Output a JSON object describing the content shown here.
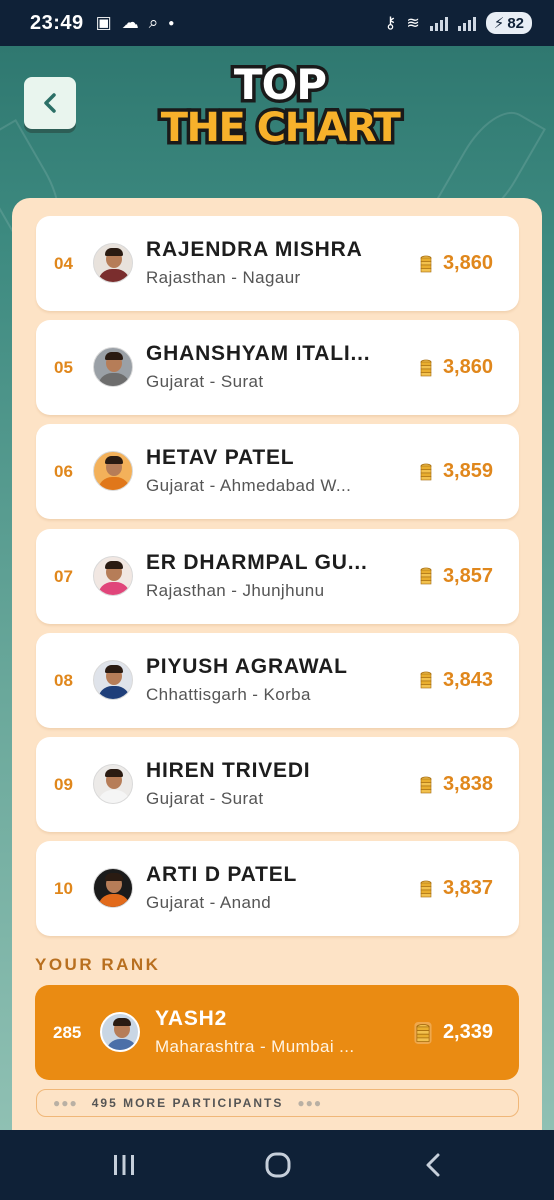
{
  "status_bar": {
    "time": "23:49",
    "battery": "82"
  },
  "header": {
    "title_line1": "TOP",
    "title_line2": "THE CHART"
  },
  "leaderboard": [
    {
      "rank": "04",
      "name": "RAJENDRA MISHRA",
      "location": "Rajasthan - Nagaur",
      "score": "3,860"
    },
    {
      "rank": "05",
      "name": "GHANSHYAM ITALI...",
      "location": "Gujarat - Surat",
      "score": "3,860"
    },
    {
      "rank": "06",
      "name": "HETAV PATEL",
      "location": "Gujarat - Ahmedabad W...",
      "score": "3,859"
    },
    {
      "rank": "07",
      "name": "ER DHARMPAL GU...",
      "location": "Rajasthan - Jhunjhunu",
      "score": "3,857"
    },
    {
      "rank": "08",
      "name": "PIYUSH AGRAWAL",
      "location": "Chhattisgarh - Korba",
      "score": "3,843"
    },
    {
      "rank": "09",
      "name": "HIREN TRIVEDI",
      "location": "Gujarat - Surat",
      "score": "3,838"
    },
    {
      "rank": "10",
      "name": "ARTI D PATEL",
      "location": "Gujarat - Anand",
      "score": "3,837"
    }
  ],
  "your_rank": {
    "label": "YOUR RANK",
    "rank": "285",
    "name": "YASH2",
    "location": "Maharashtra - Mumbai ...",
    "score": "2,339"
  },
  "more_participants": "495 MORE PARTICIPANTS",
  "colors": {
    "accent_orange": "#ea8b12",
    "rank_orange": "#e0871c",
    "panel_bg": "#fde3c6",
    "teal_bg": "#3d8a80"
  }
}
